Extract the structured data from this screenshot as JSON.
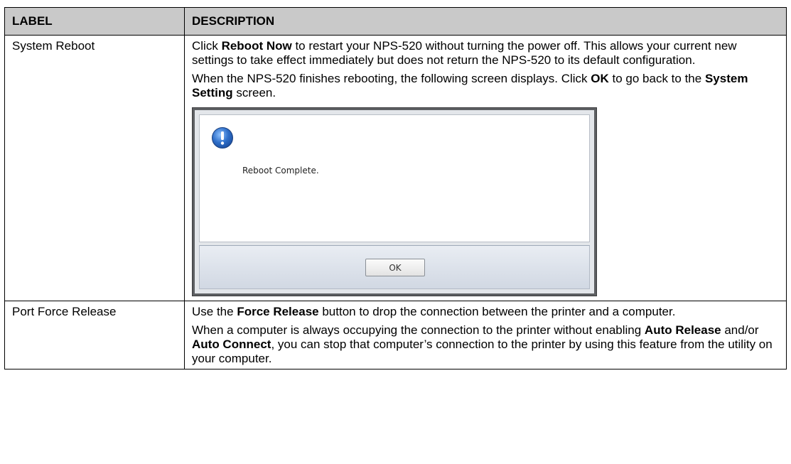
{
  "table": {
    "headers": [
      "LABEL",
      "DESCRIPTION"
    ],
    "rows": [
      {
        "label": "System Reboot",
        "p1": {
          "a": "Click ",
          "b": "Reboot Now",
          "c": " to restart your NPS-520 without turning the power off. This allows your current new settings to take effect immediately but does not return the NPS-520 to its default configuration."
        },
        "p2": {
          "a": "When the NPS-520 finishes rebooting, the following screen displays. Click ",
          "b": "OK",
          "c": " to go back to the ",
          "d": "System Setting",
          "e": " screen."
        },
        "dialog": {
          "icon": "exclamation-info-icon",
          "message": "Reboot Complete.",
          "ok_label": "OK"
        }
      },
      {
        "label": "Port Force Release",
        "p1": {
          "a": "Use the ",
          "b": "Force Release",
          "c": " button to drop the connection between the printer and a computer."
        },
        "p2": {
          "a": "When a computer is always occupying the connection to the printer without enabling ",
          "b": "Auto Release",
          "c": " and/or ",
          "d": "Auto Connect",
          "e": ", you can stop that computer’s connection to the printer by using this feature from the utility on your computer."
        }
      }
    ]
  },
  "colors": {
    "header_bg": "#c9c9c9",
    "border": "#000000",
    "icon_blue": "#2f6fc9"
  }
}
